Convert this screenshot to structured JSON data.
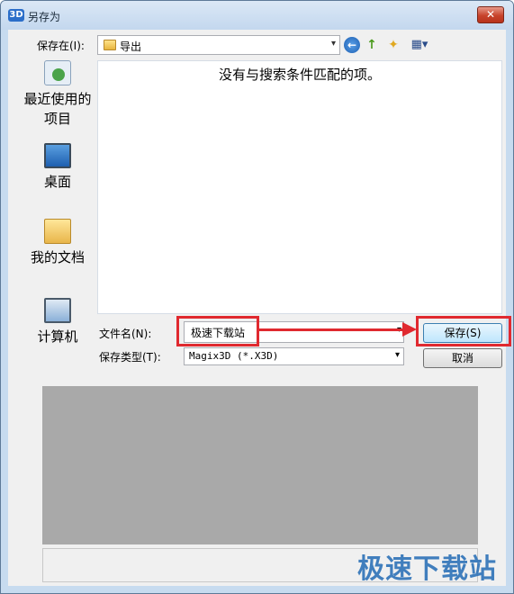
{
  "window": {
    "title": "另存为",
    "app_icon_text": "3D",
    "close_glyph": "✕"
  },
  "toolbar": {
    "lookin_label": "保存在(I):",
    "lookin_value": "导出",
    "combo_arrow": "▾",
    "back_glyph": "←",
    "up_glyph": "↑",
    "newfolder_glyph": "✦",
    "views_glyph": "▦▾"
  },
  "places": [
    {
      "label": "最近使用的\n项目",
      "icon": "recent-icon"
    },
    {
      "label": "桌面",
      "icon": "desktop-icon"
    },
    {
      "label": "我的文档",
      "icon": "documents-icon"
    },
    {
      "label": "计算机",
      "icon": "computer-icon"
    }
  ],
  "file_list": {
    "empty_message": "没有与搜索条件匹配的项。"
  },
  "filename": {
    "label": "文件名(N):",
    "value": "极速下载站"
  },
  "filetype": {
    "label": "保存类型(T):",
    "value": "Magix3D (*.X3D)"
  },
  "buttons": {
    "save": "保存(S)",
    "cancel": "取消"
  },
  "watermark": "极速下载站",
  "colors": {
    "highlight": "#e0292f",
    "accent": "#2e72b8"
  }
}
